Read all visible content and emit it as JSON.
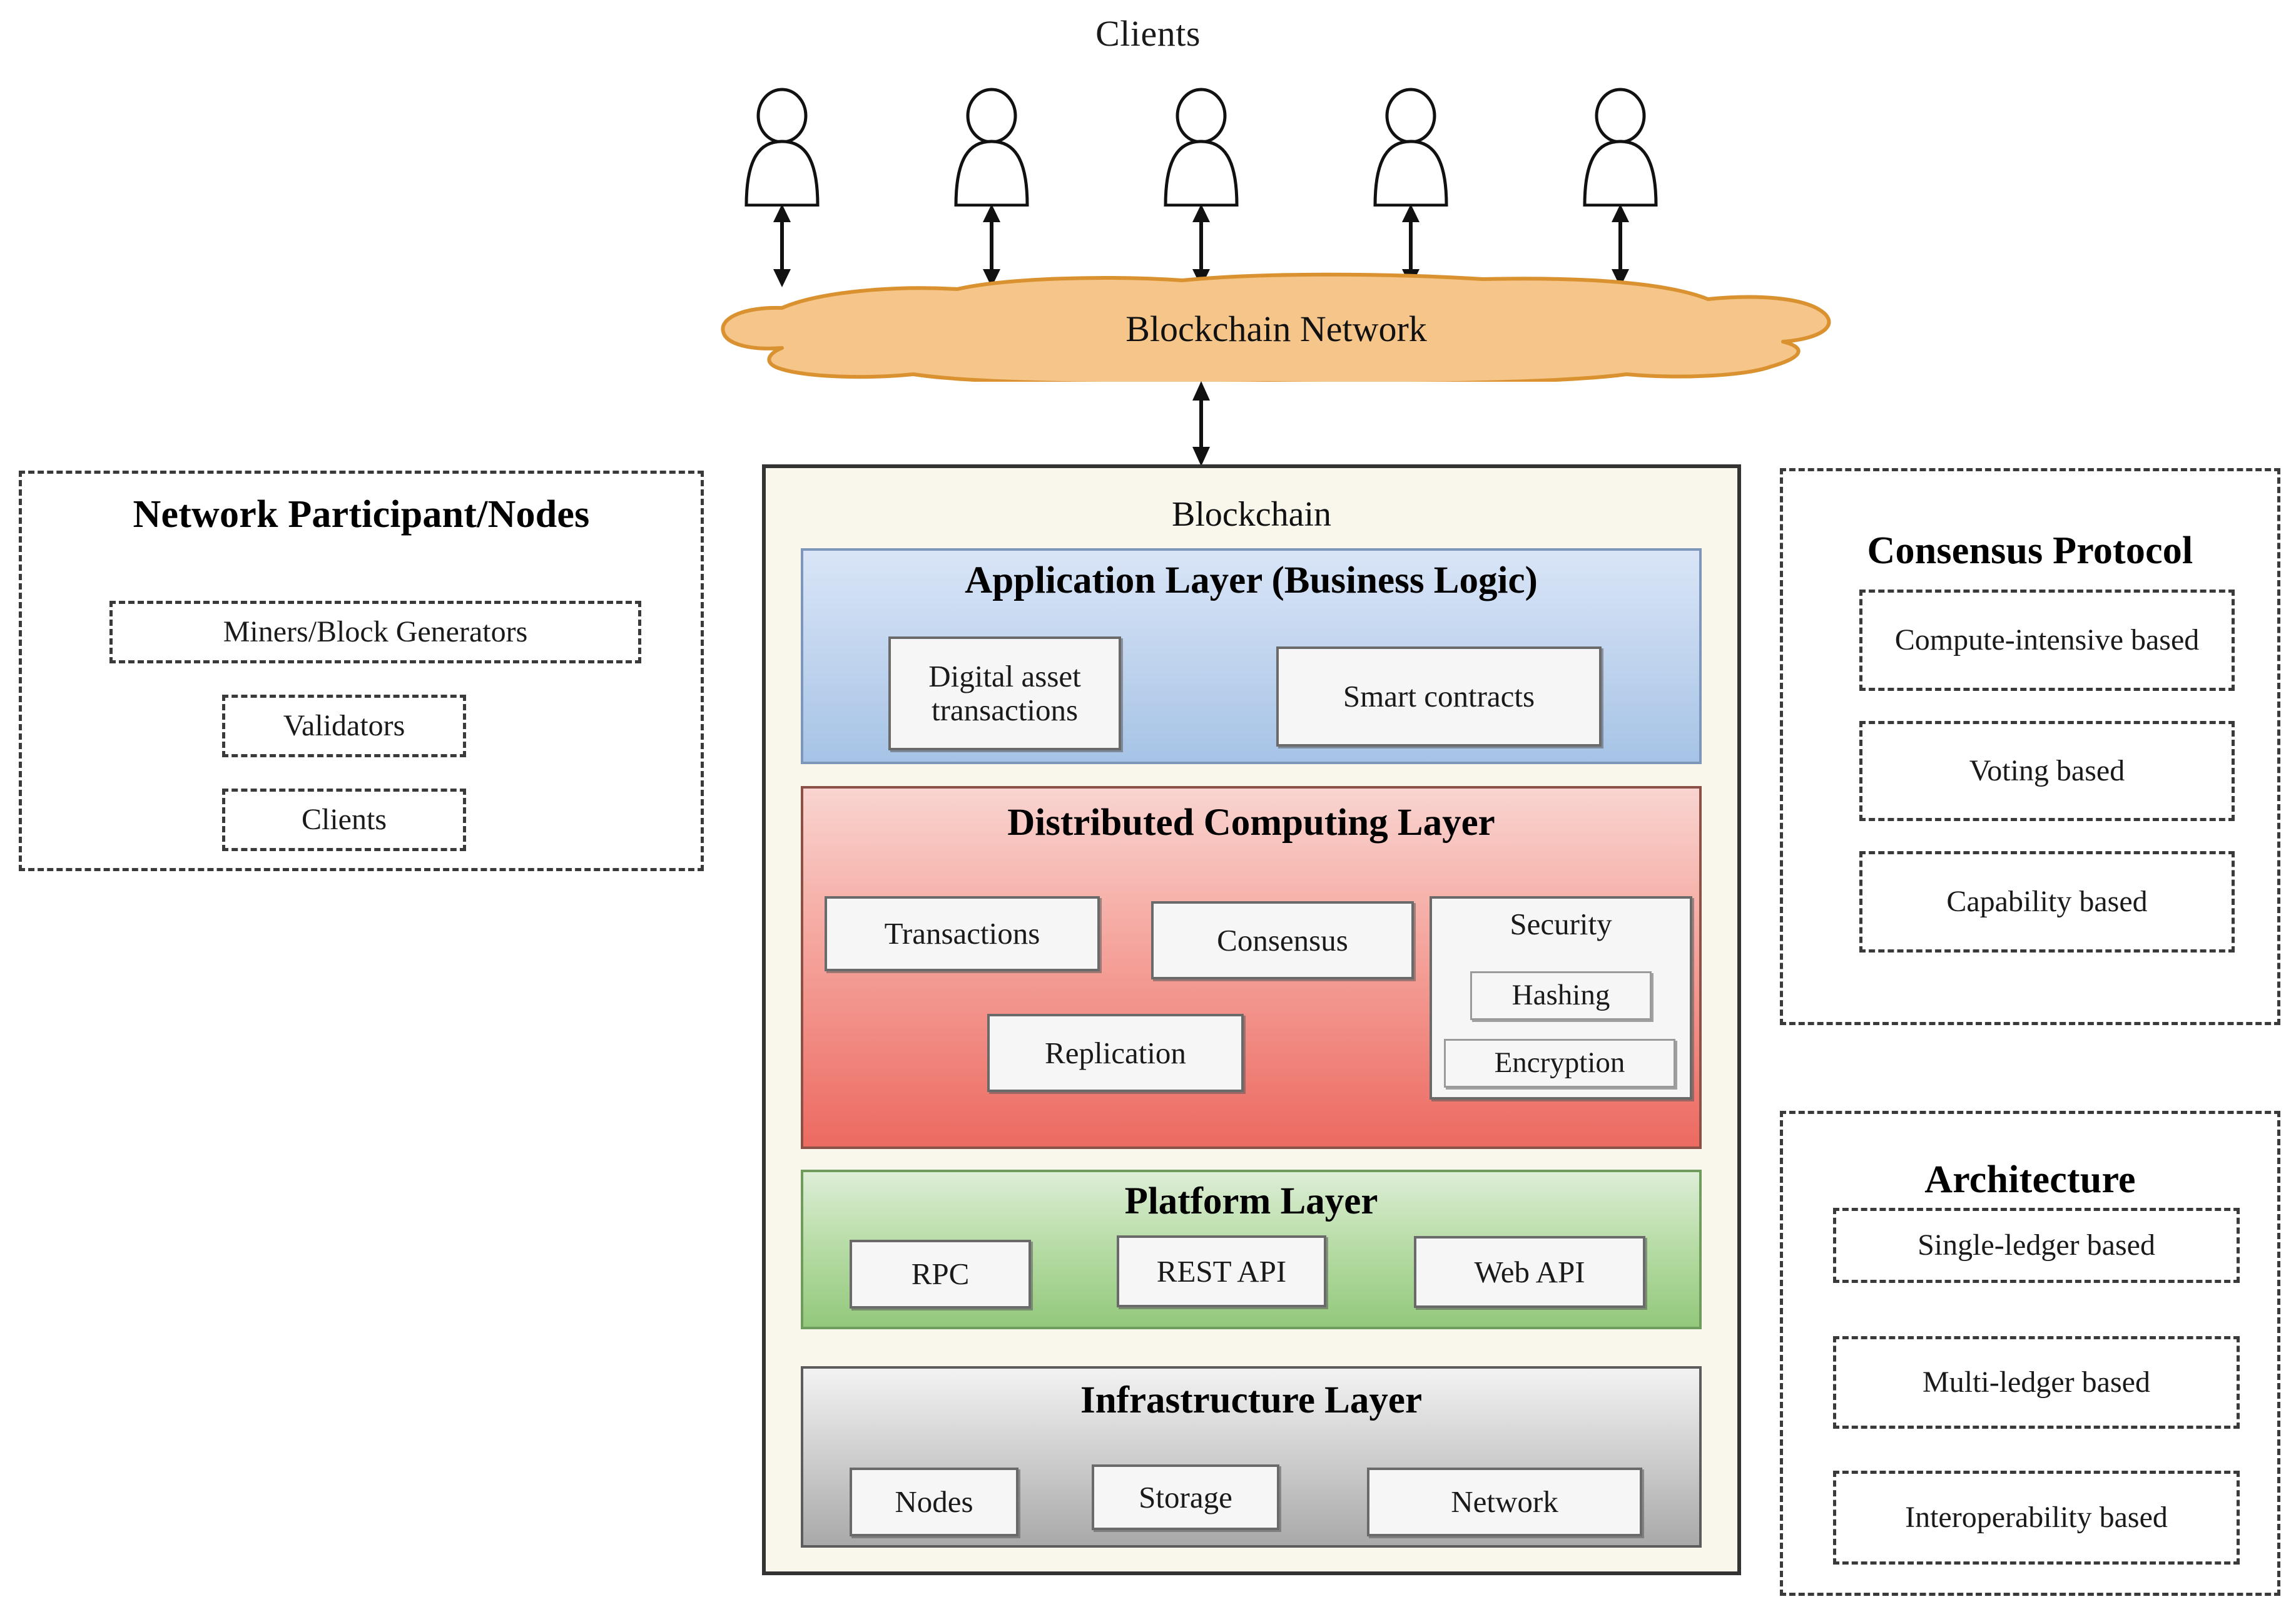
{
  "clients": {
    "title": "Clients",
    "count": 5,
    "icon": "person-icon"
  },
  "network": {
    "cloud_label": "Blockchain Network",
    "cloud_fill": "#f5c58a",
    "cloud_stroke": "#d9922f"
  },
  "left_panel": {
    "title": "Network Participant/Nodes",
    "items": [
      {
        "label": "Miners/Block Generators"
      },
      {
        "label": "Validators"
      },
      {
        "label": "Clients"
      }
    ]
  },
  "blockchain": {
    "title": "Blockchain",
    "layers": [
      {
        "id": "application",
        "title": "Application Layer (Business Logic)",
        "color": "#a6c3e6",
        "items": [
          {
            "label": "Digital asset transactions"
          },
          {
            "label": "Smart contracts"
          }
        ]
      },
      {
        "id": "distributed",
        "title": "Distributed Computing Layer",
        "color": "#ec6a61",
        "items": [
          {
            "label": "Transactions"
          },
          {
            "label": "Consensus"
          },
          {
            "label": "Replication"
          },
          {
            "label": "Security",
            "children": [
              {
                "label": "Hashing"
              },
              {
                "label": "Encryption"
              }
            ]
          }
        ]
      },
      {
        "id": "platform",
        "title": "Platform Layer",
        "color": "#93c87c",
        "items": [
          {
            "label": "RPC"
          },
          {
            "label": "REST API"
          },
          {
            "label": "Web API"
          }
        ]
      },
      {
        "id": "infrastructure",
        "title": "Infrastructure Layer",
        "color": "#a9a9a9",
        "items": [
          {
            "label": "Nodes"
          },
          {
            "label": "Storage"
          },
          {
            "label": "Network"
          }
        ]
      }
    ]
  },
  "consensus_panel": {
    "title": "Consensus Protocol",
    "items": [
      {
        "label": "Compute-intensive based"
      },
      {
        "label": "Voting based"
      },
      {
        "label": "Capability based"
      }
    ]
  },
  "architecture_panel": {
    "title": "Architecture",
    "items": [
      {
        "label": "Single-ledger based"
      },
      {
        "label": "Multi-ledger based"
      },
      {
        "label": "Interoperability based"
      }
    ]
  }
}
